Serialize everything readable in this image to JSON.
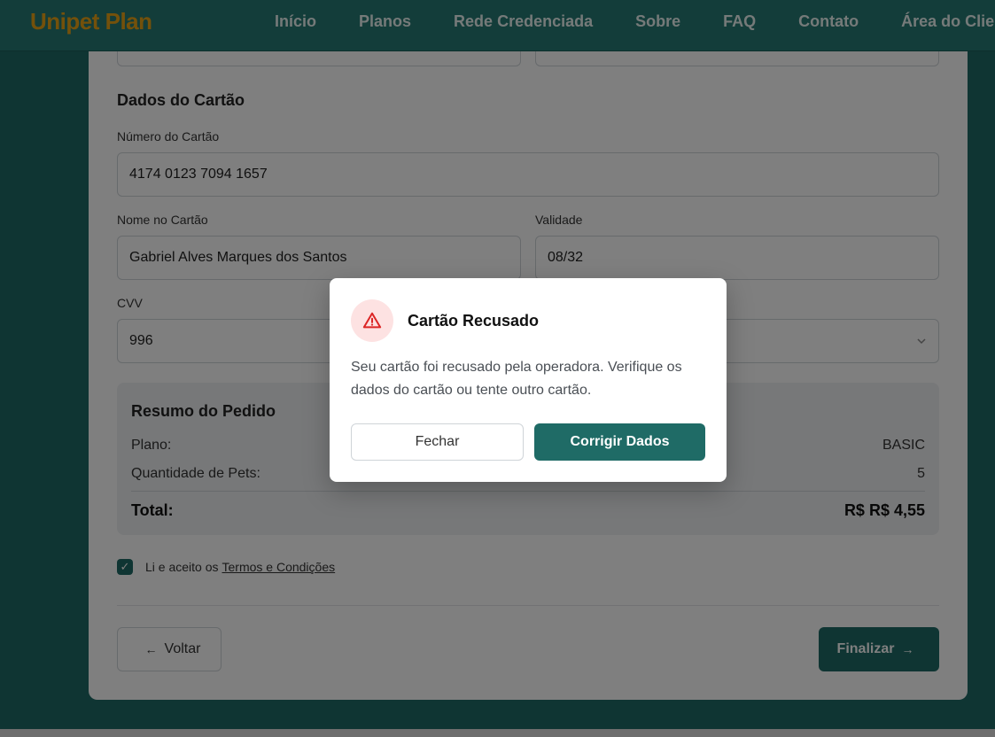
{
  "brand": {
    "logo": "Unipet Plan",
    "logo_color": "#e8a317",
    "primary_color": "#1f6b66"
  },
  "nav": {
    "items": [
      {
        "label": "Início"
      },
      {
        "label": "Planos"
      },
      {
        "label": "Rede Credenciada"
      },
      {
        "label": "Sobre"
      },
      {
        "label": "FAQ"
      },
      {
        "label": "Contato"
      },
      {
        "label": "Área do Clier"
      }
    ]
  },
  "card_section": {
    "title": "Dados do Cartão",
    "card_number": {
      "label": "Número do Cartão",
      "value": "4174 0123 7094 1657"
    },
    "card_name": {
      "label": "Nome no Cartão",
      "value": "Gabriel Alves Marques dos Santos"
    },
    "expiry": {
      "label": "Validade",
      "value": "08/32"
    },
    "cvv": {
      "label": "CVV",
      "value": "996"
    },
    "installments_icon": "chevron-down-icon"
  },
  "summary": {
    "title": "Resumo do Pedido",
    "plan_label": "Plano:",
    "plan_value": "BASIC",
    "pets_label": "Quantidade de Pets:",
    "pets_value": "5",
    "total_label": "Total:",
    "total_value": "R$ R$ 4,55"
  },
  "terms": {
    "checked": true,
    "text": "Li e aceito os",
    "link": "Termos e Condições"
  },
  "actions": {
    "back_label": "Voltar",
    "finish_label": "Finalizar"
  },
  "modal": {
    "icon": "warning-icon",
    "title": "Cartão Recusado",
    "message": "Seu cartão foi recusado pela operadora. Verifique os dados do cartão ou tente outro cartão.",
    "close_label": "Fechar",
    "fix_label": "Corrigir Dados"
  }
}
